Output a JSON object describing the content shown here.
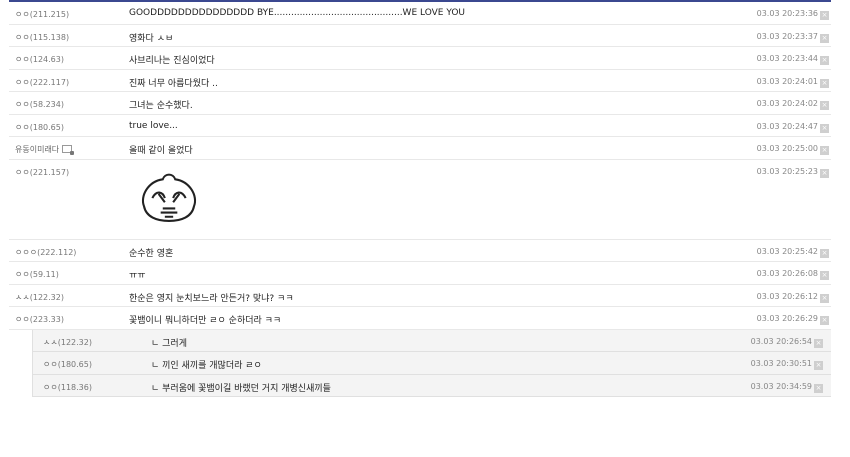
{
  "comments": [
    {
      "nick": "ㅇㅇ",
      "ip": "(211.215)",
      "text": "GOODDDDDDDDDDDDDDD BYE.............................................WE LOVE YOU",
      "time": "03.03 20:23:36"
    },
    {
      "nick": "ㅇㅇ",
      "ip": "(115.138)",
      "text": "영화다 ㅅㅂ",
      "time": "03.03 20:23:37"
    },
    {
      "nick": "ㅇㅇ",
      "ip": "(124.63)",
      "text": "사브리나는 진심이었다",
      "time": "03.03 20:23:44"
    },
    {
      "nick": "ㅇㅇ",
      "ip": "(222.117)",
      "text": "진짜 너무 아름다웠다 ..",
      "time": "03.03 20:24:01"
    },
    {
      "nick": "ㅇㅇ",
      "ip": "(58.234)",
      "text": "그녀는 순수했다.",
      "time": "03.03 20:24:02"
    },
    {
      "nick": "ㅇㅇ",
      "ip": "(180.65)",
      "text": "true love...",
      "time": "03.03 20:24:47"
    },
    {
      "nick": "유동이미래다",
      "ip": "",
      "text": "올때 같이 올었다",
      "time": "03.03 20:25:00",
      "badge": true
    },
    {
      "nick": "ㅇㅇ",
      "ip": "(221.157)",
      "text": "",
      "time": "03.03 20:25:23",
      "emoticon": true
    },
    {
      "nick": "ㅇㅇㅇ",
      "ip": "(222.112)",
      "text": "순수한 영혼",
      "time": "03.03 20:25:42"
    },
    {
      "nick": "ㅇㅇ",
      "ip": "(59.11)",
      "text": "ㅠㅠ",
      "time": "03.03 20:26:08"
    },
    {
      "nick": "ㅅㅅ",
      "ip": "(122.32)",
      "text": "한순은 영지 눈치보느라 안든거? 맞냐? ㅋㅋ",
      "time": "03.03 20:26:12"
    },
    {
      "nick": "ㅇㅇ",
      "ip": "(223.33)",
      "text": "꽃뱀이니 뭐니하더만 ㄹㅇ 순하더라 ㅋㅋ",
      "time": "03.03 20:26:29"
    }
  ],
  "replies": [
    {
      "nick": "ㅅㅅ",
      "ip": "(122.32)",
      "text": "ㄴ 그러게",
      "time": "03.03 20:26:54"
    },
    {
      "nick": "ㅇㅇ",
      "ip": "(180.65)",
      "text": "ㄴ 끼인 새끼를 개많더라 ㄹㅇ",
      "time": "03.03 20:30:51"
    },
    {
      "nick": "ㅇㅇ",
      "ip": "(118.36)",
      "text": "ㄴ 부러움에 꽃뱀이길 바랬던 거지 개병신새끼들",
      "time": "03.03 20:34:59"
    }
  ],
  "delete_glyph": "×"
}
